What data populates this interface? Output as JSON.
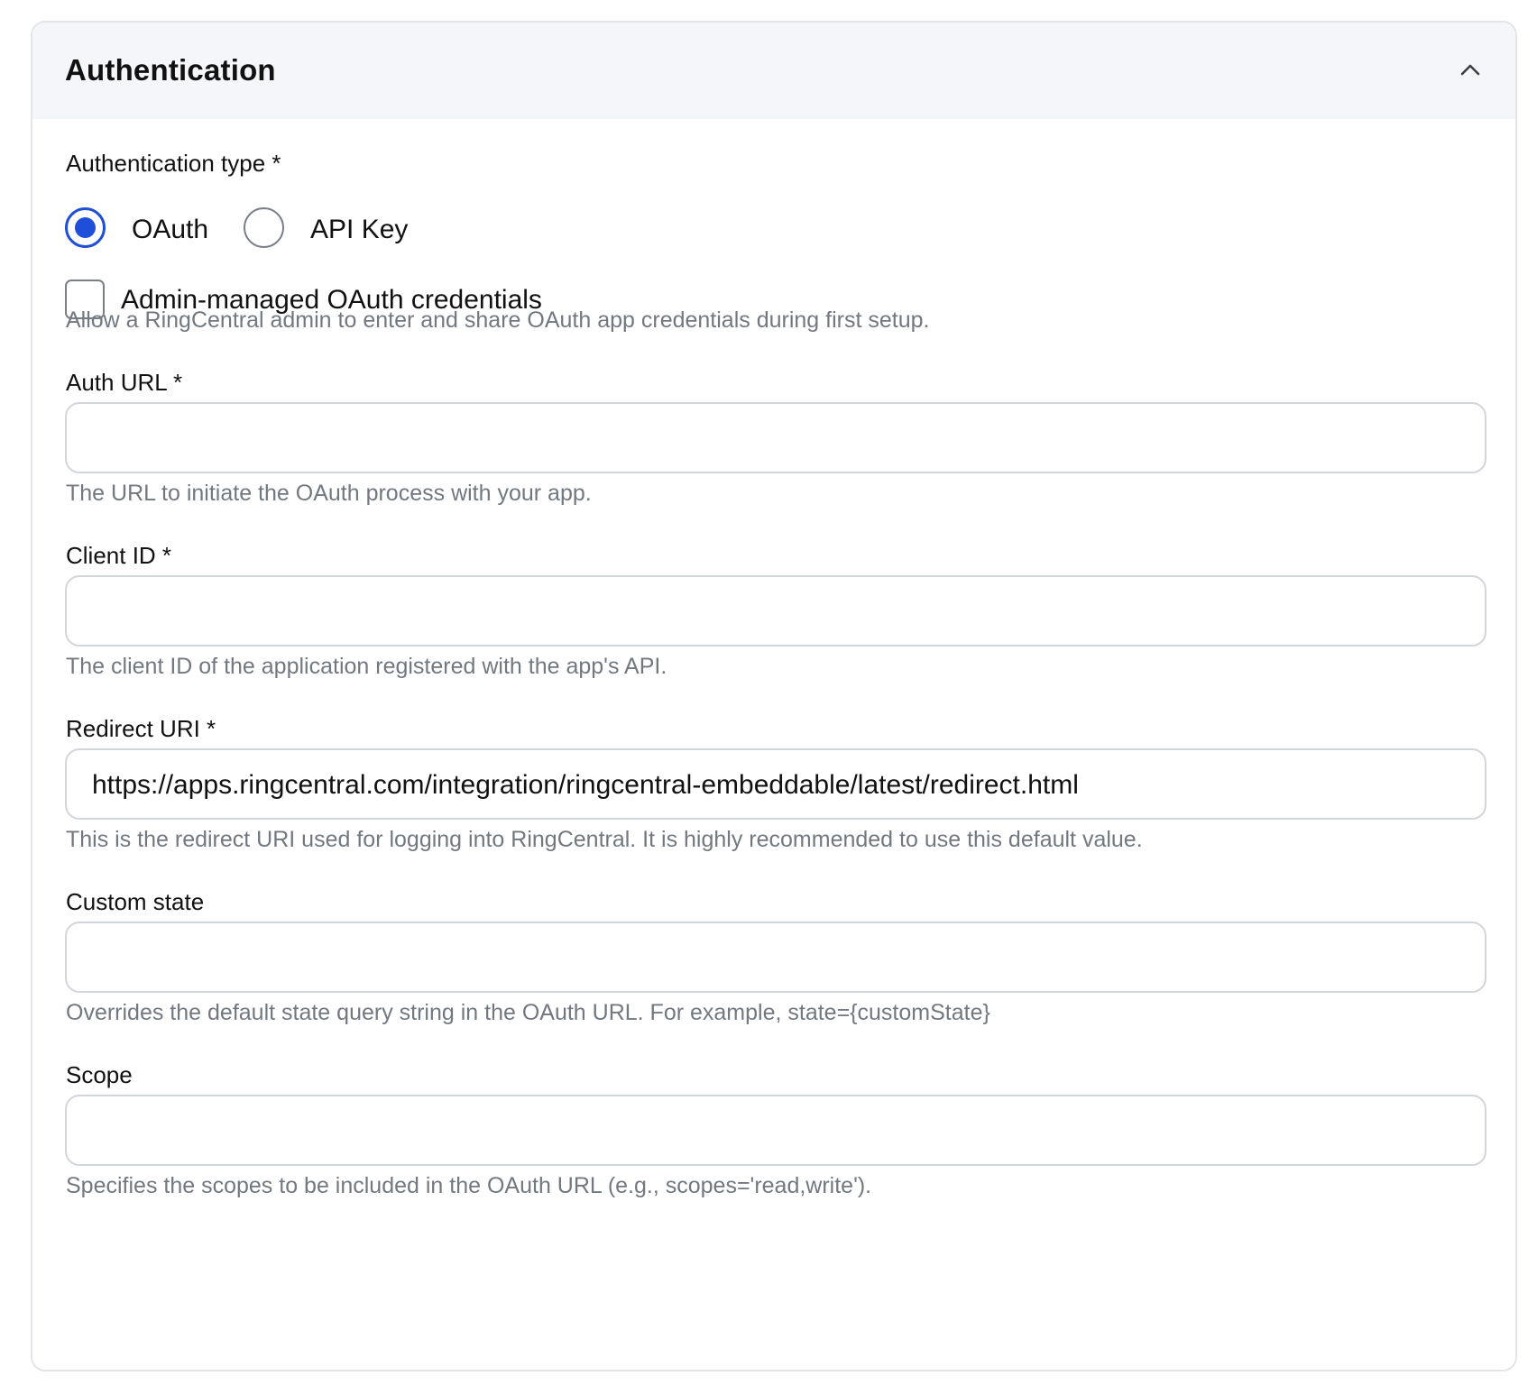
{
  "section": {
    "title": "Authentication"
  },
  "auth_type": {
    "label": "Authentication type *",
    "options": [
      {
        "label": "OAuth",
        "selected": true
      },
      {
        "label": "API Key",
        "selected": false
      }
    ]
  },
  "admin_managed": {
    "label": "Admin-managed OAuth credentials",
    "checked": false,
    "hint": "Allow a RingCentral admin to enter and share OAuth app credentials during first setup."
  },
  "fields": {
    "auth_url": {
      "label": "Auth URL *",
      "value": "",
      "hint": "The URL to initiate the OAuth process with your app."
    },
    "client_id": {
      "label": "Client ID *",
      "value": "",
      "hint": "The client ID of the application registered with the app's API."
    },
    "redirect_uri": {
      "label": "Redirect URI *",
      "value": "https://apps.ringcentral.com/integration/ringcentral-embeddable/latest/redirect.html",
      "hint": "This is the redirect URI used for logging into RingCentral. It is highly recommended to use this default value."
    },
    "custom_state": {
      "label": "Custom state",
      "value": "",
      "hint": "Overrides the default state query string in the OAuth URL. For example, state={customState}"
    },
    "scope": {
      "label": "Scope",
      "value": "",
      "hint": "Specifies the scopes to be included in the OAuth URL (e.g., scopes='read,write')."
    }
  },
  "colors": {
    "accent": "#1f4ed8",
    "header_bg": "#f5f6f9",
    "border": "#d2d5da",
    "hint_text": "#737880"
  },
  "icons": {
    "collapse": "chevron-up-icon"
  }
}
